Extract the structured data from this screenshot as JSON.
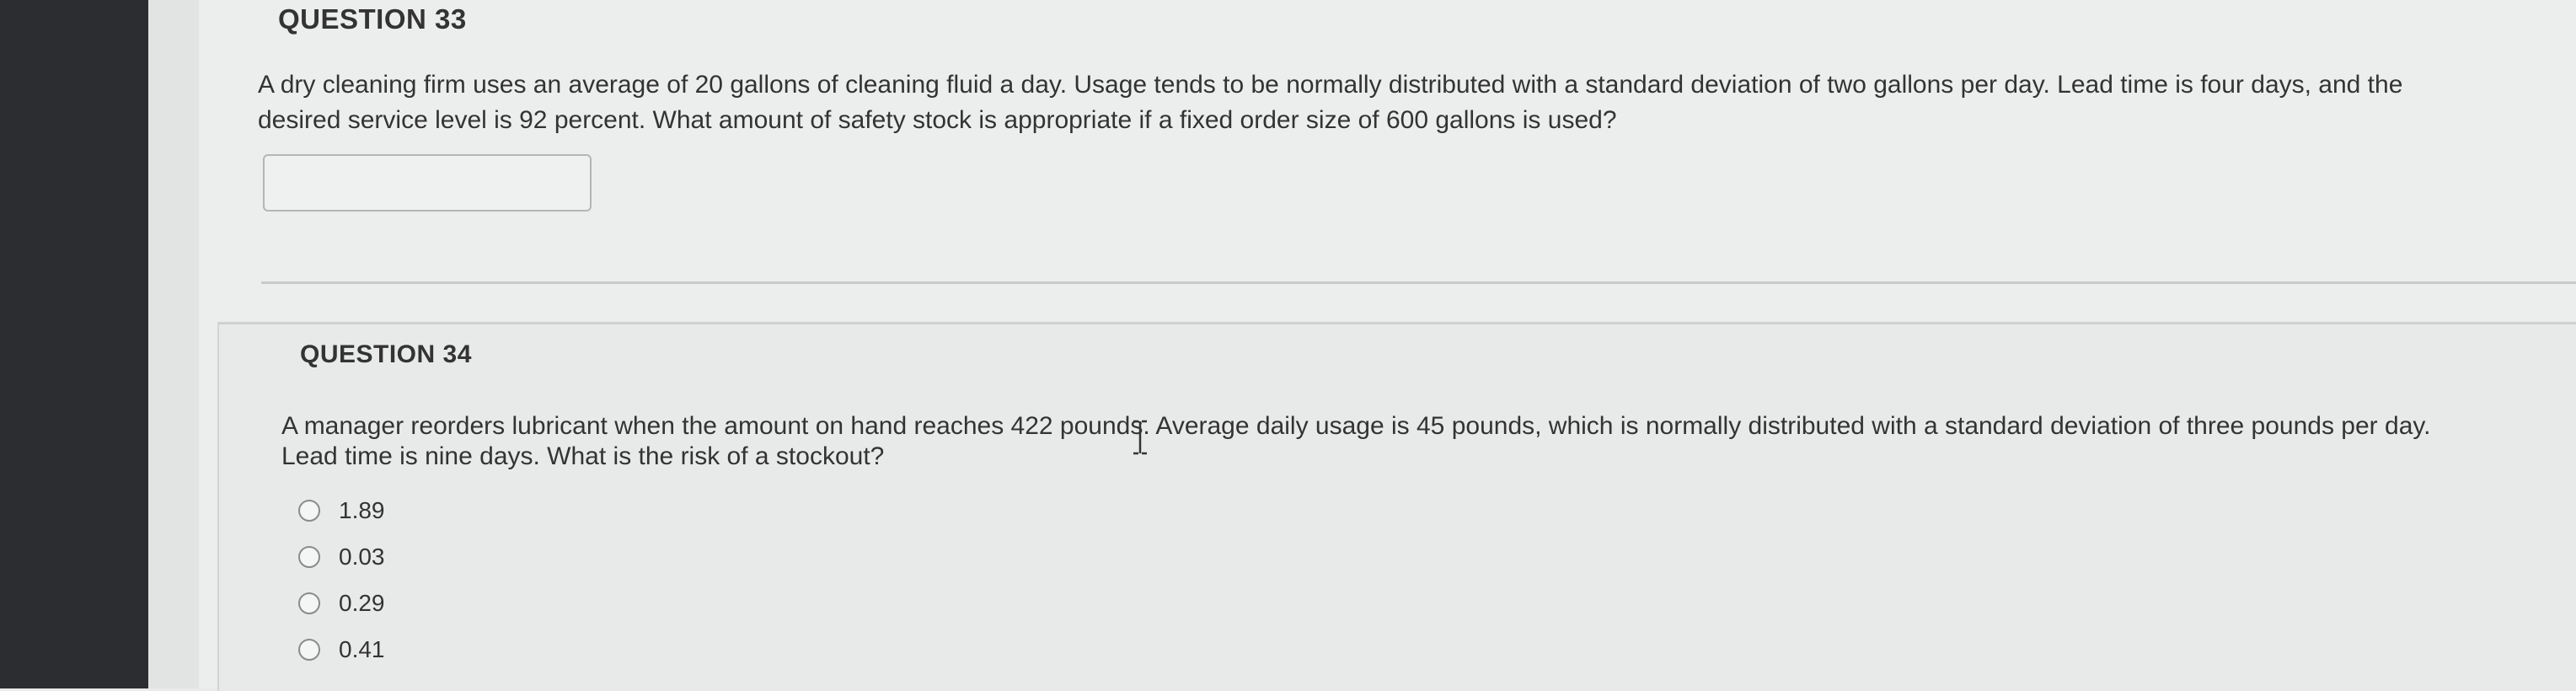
{
  "question33": {
    "title": "QUESTION 33",
    "text_line1": "A dry cleaning firm uses an average of 20 gallons of cleaning fluid a day. Usage tends to be normally distributed with a standard deviation of two gallons per day. Lead time is four days, and the",
    "text_line2": "desired service level is 92 percent. What amount of safety stock is appropriate if a fixed order size of 600 gallons is used?",
    "answer_value": ""
  },
  "question34": {
    "title": "QUESTION 34",
    "text_line1": "A manager reorders lubricant when the amount on hand reaches 422 pounds. Average daily usage is 45 pounds, which is normally distributed with a standard deviation of three pounds per day.",
    "text_line2": "Lead time is nine days. What is the risk of a stockout?",
    "options": [
      {
        "label": "1.89",
        "selected": false
      },
      {
        "label": "0.03",
        "selected": false
      },
      {
        "label": "0.29",
        "selected": false
      },
      {
        "label": "0.41",
        "selected": false
      }
    ]
  },
  "icons": {
    "cursor": "text-cursor-icon",
    "radio": "radio-button-icon"
  },
  "colors": {
    "page_background": "#eceeed",
    "left_bezel": "#2b2d30",
    "text": "#333333",
    "border": "#b4b6b5"
  }
}
